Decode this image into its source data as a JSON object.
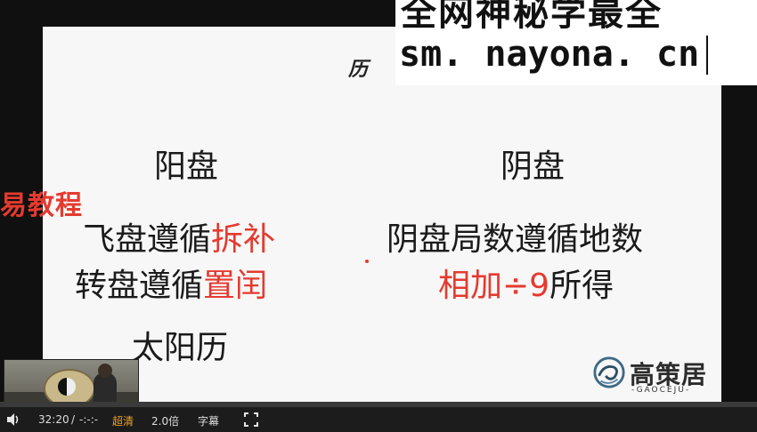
{
  "slide": {
    "title_partial": "历",
    "left": {
      "heading": "阳盘",
      "line1_black": "飞盘遵循",
      "line1_red": "拆补",
      "line2_black": "转盘遵循",
      "line2_red": "置闰",
      "line3": "太阳历"
    },
    "right": {
      "heading": "阴盘",
      "line1": "阴盘局数遵循地数",
      "line2_red": "相加÷9",
      "line2_black": "所得"
    },
    "logo": {
      "text": "高策居",
      "sub": "-GAOCEJU-"
    }
  },
  "watermark": {
    "top": "全网神秘学最全",
    "url": "sm. nayona. cn"
  },
  "side_label": "易教程",
  "player": {
    "time_current": "32:20",
    "time_separator": "/",
    "time_total": "-:-:-",
    "quality": "超清",
    "speed": "2.0倍",
    "subtitles": "字幕",
    "progress": 0.0
  },
  "colors": {
    "accent_red": "#e53a2f",
    "quality_orange": "#f0a020"
  }
}
